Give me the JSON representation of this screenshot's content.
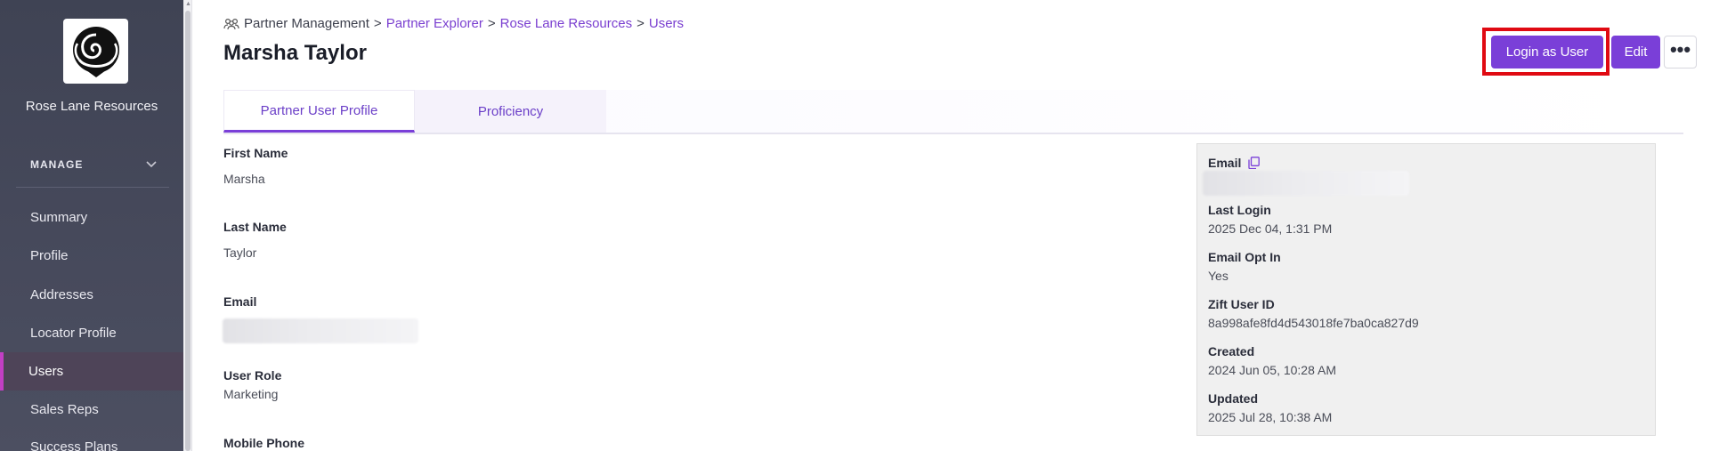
{
  "sidebar": {
    "org_name": "Rose Lane Resources",
    "section_label": "MANAGE",
    "items": [
      {
        "label": "Summary"
      },
      {
        "label": "Profile"
      },
      {
        "label": "Addresses"
      },
      {
        "label": "Locator Profile"
      },
      {
        "label": "Users",
        "active": true
      },
      {
        "label": "Sales Reps"
      },
      {
        "label": "Success Plans"
      }
    ]
  },
  "breadcrumb": {
    "icon": "people-icon",
    "root": "Partner Management",
    "separator": ">",
    "links": [
      "Partner Explorer",
      "Rose Lane Resources",
      "Users"
    ]
  },
  "header": {
    "title": "Marsha Taylor",
    "login_label": "Login as User",
    "edit_label": "Edit",
    "more_label": "•••"
  },
  "tabs": [
    {
      "label": "Partner User Profile",
      "active": true
    },
    {
      "label": "Proficiency",
      "active": false
    }
  ],
  "fields": {
    "first_name": {
      "label": "First Name",
      "value": "Marsha"
    },
    "last_name": {
      "label": "Last Name",
      "value": "Taylor"
    },
    "email": {
      "label": "Email"
    },
    "user_role": {
      "label": "User Role",
      "value": "Marketing"
    },
    "mobile_phone": {
      "label": "Mobile Phone"
    }
  },
  "info": {
    "email": {
      "label": "Email"
    },
    "last_login": {
      "label": "Last Login",
      "value": "2025 Dec 04, 1:31 PM"
    },
    "email_opt_in": {
      "label": "Email Opt In",
      "value": "Yes"
    },
    "zift_user_id": {
      "label": "Zift User ID",
      "value": "8a998afe8fd4d543018fe7ba0ca827d9"
    },
    "created": {
      "label": "Created",
      "value": "2024 Jun 05, 10:28 AM"
    },
    "updated": {
      "label": "Updated",
      "value": "2025 Jul 28, 10:38 AM"
    }
  },
  "colors": {
    "accent": "#7a3fd8",
    "highlight": "#e00a12",
    "sidebar_bg": "#44475a",
    "active_indicator": "#c23fc4"
  }
}
